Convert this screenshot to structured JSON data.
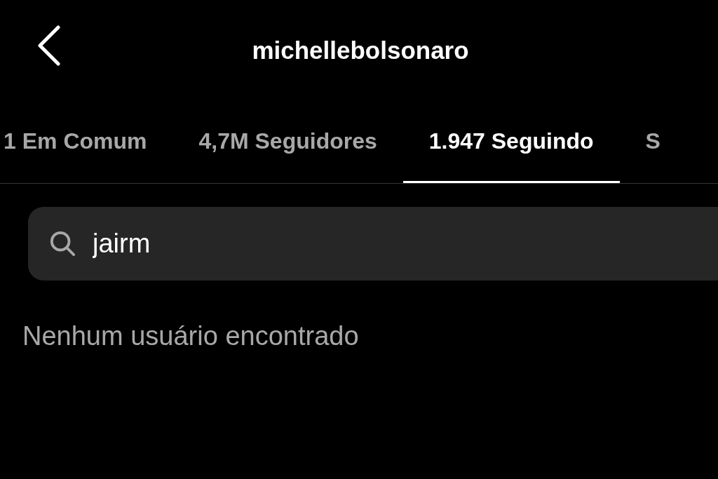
{
  "header": {
    "title": "michellebolsonaro"
  },
  "tabs": [
    {
      "label": "1 Em Comum",
      "selected": false
    },
    {
      "label": "4,7M Seguidores",
      "selected": false
    },
    {
      "label": "1.947 Seguindo",
      "selected": true
    },
    {
      "label": "S",
      "selected": false
    }
  ],
  "search": {
    "value": "jairm"
  },
  "message": "Nenhum usuário encontrado"
}
